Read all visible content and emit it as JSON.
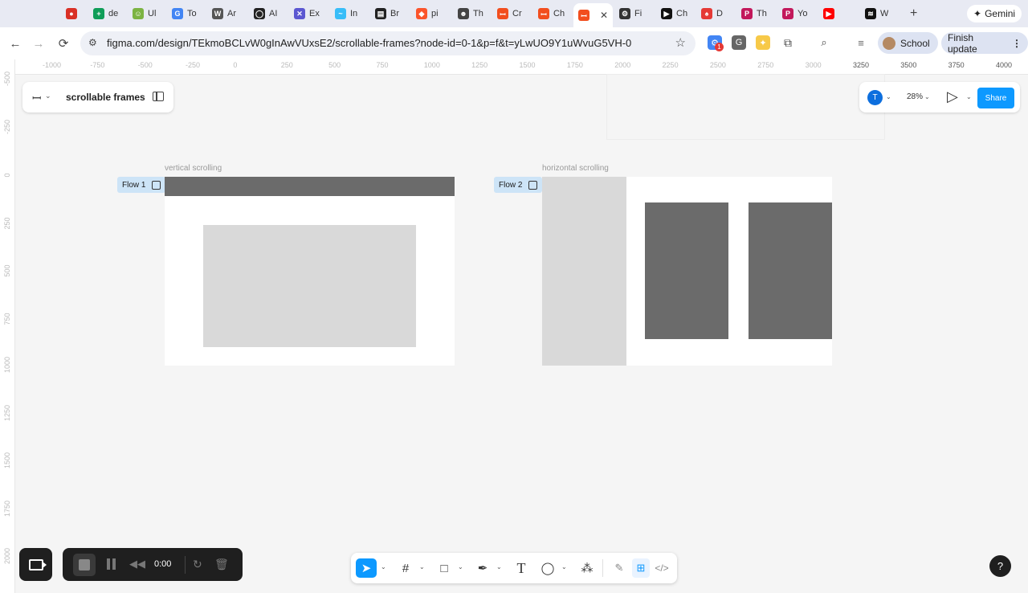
{
  "browser": {
    "tabs": [
      {
        "title": "",
        "icon": "red-circle-icon",
        "color": "#d93025"
      },
      {
        "title": "de",
        "icon": "sheets-icon",
        "color": "#0f9d58"
      },
      {
        "title": "Ul",
        "icon": "smile-icon",
        "color": "#7cb342"
      },
      {
        "title": "To",
        "icon": "google-icon",
        "color": "#4285f4"
      },
      {
        "title": "Ar",
        "icon": "wikipedia-icon",
        "color": "#555555"
      },
      {
        "title": "AI",
        "icon": "openai-icon",
        "color": "#222222"
      },
      {
        "title": "Ex",
        "icon": "excalidraw-icon",
        "color": "#5b57d1"
      },
      {
        "title": "In",
        "icon": "tailwind-icon",
        "color": "#38bdf8"
      },
      {
        "title": "Br",
        "icon": "news-icon",
        "color": "#222222"
      },
      {
        "title": "pi",
        "icon": "brave-icon",
        "color": "#fb542b"
      },
      {
        "title": "Th",
        "icon": "face-icon",
        "color": "#444444"
      },
      {
        "title": "Cr",
        "icon": "figma-icon",
        "color": "#f24e1e"
      },
      {
        "title": "Ch",
        "icon": "figma-icon",
        "color": "#f24e1e"
      },
      {
        "title": "",
        "icon": "figma-icon",
        "color": "#f24e1e",
        "active": true
      },
      {
        "title": "Fi",
        "icon": "chatgpt-icon",
        "color": "#333333"
      },
      {
        "title": "Ch",
        "icon": "play-icon",
        "color": "#111111"
      },
      {
        "title": "D",
        "icon": "tulip-icon",
        "color": "#e53935"
      },
      {
        "title": "Th",
        "icon": "p-icon",
        "color": "#c2185b"
      },
      {
        "title": "Yo",
        "icon": "p-icon",
        "color": "#c2185b"
      },
      {
        "title": "",
        "icon": "youtube-icon",
        "color": "#ff0000"
      },
      {
        "title": "W",
        "icon": "spotify-icon",
        "color": "#111111"
      }
    ],
    "new_tab": "+",
    "gemini_label": "Gemini",
    "url": "figma.com/design/TEkmoBCLvW0gInAwVUxsE2/scrollable-frames?node-id=0-1&p=f&t=yLwUO9Y1uWvuG5VH-0",
    "extension_badge": "1",
    "profile_label": "School",
    "update_label": "Finish update"
  },
  "figma": {
    "file_name": "scrollable frames",
    "user_initial": "T",
    "zoom": "28%",
    "share_label": "Share",
    "ruler_h": [
      "-1000",
      "-750",
      "-500",
      "-250",
      "0",
      "250",
      "500",
      "750",
      "1000",
      "1250",
      "1500",
      "1750",
      "2000",
      "2250",
      "2500",
      "2750",
      "3000",
      "3250",
      "3500",
      "3750",
      "4000"
    ],
    "ruler_v": [
      "-500",
      "-250",
      "0",
      "250",
      "500",
      "750",
      "1000",
      "1250",
      "1500",
      "1750",
      "2000"
    ],
    "frames": [
      {
        "label": "vertical scrolling",
        "flow": "Flow 1"
      },
      {
        "label": "horizontal scrolling",
        "flow": "Flow 2"
      }
    ],
    "recorder_time": "0:00",
    "help_label": "?"
  },
  "colors": {
    "canvas": "#f5f5f5",
    "dark_block": "#6b6b6b",
    "light_block": "#d9d9d9",
    "accent": "#0d99ff",
    "flow_tag": "#cde4f7"
  }
}
